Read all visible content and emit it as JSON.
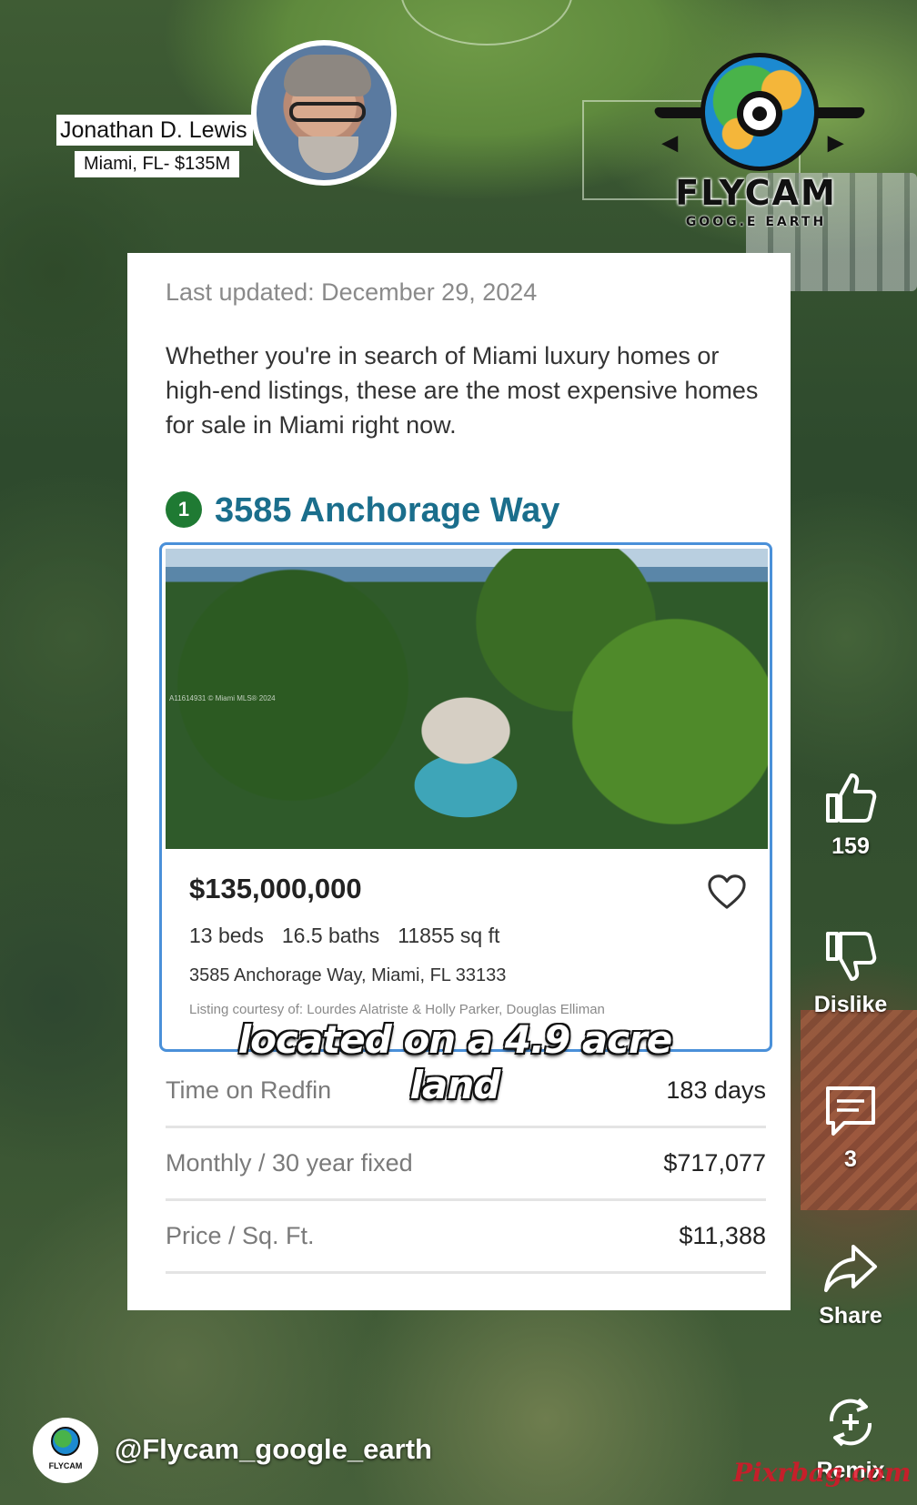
{
  "creator": {
    "name": "Jonathan D. Lewis",
    "subtitle": "Miami, FL- $135M"
  },
  "logo": {
    "title": "FLYCAM",
    "subtitle": "GOOG.E EARTH"
  },
  "article": {
    "last_updated": "Last updated: December 29, 2024",
    "intro": "Whether you're in search of Miami luxury homes or high-end listings, these are the most expensive homes for sale in Miami right now."
  },
  "listing": {
    "rank": "1",
    "title": "3585 Anchorage Way",
    "photo_watermark": "A11614931 © Miami MLS® 2024",
    "price": "$135,000,000",
    "beds": "13 beds",
    "baths": "16.5 baths",
    "sqft": "11855 sq ft",
    "address": "3585 Anchorage Way, Miami, FL 33133",
    "courtesy": "Listing courtesy of: Lourdes Alatriste & Holly Parker, Douglas Elliman",
    "favorite_icon": "heart-outline-icon"
  },
  "stats": [
    {
      "label": "Time on Redfin",
      "value": "183 days"
    },
    {
      "label": "Monthly / 30 year fixed",
      "value": "$717,077"
    },
    {
      "label": "Price / Sq. Ft.",
      "value": "$11,388"
    }
  ],
  "caption": {
    "line1": "located on a 4.9 acre",
    "line2": "land"
  },
  "rail": {
    "like_count": "159",
    "dislike_label": "Dislike",
    "comment_count": "3",
    "share_label": "Share",
    "remix_label": "Remix"
  },
  "channel": {
    "avatar_text": "FLYCAM",
    "handle": "@Flycam_google_earth"
  },
  "watermark": "Pixrbag.com",
  "colors": {
    "title_blue": "#1a6e8c",
    "rank_green": "#1f7a33",
    "frame_blue": "#4a90d9"
  }
}
